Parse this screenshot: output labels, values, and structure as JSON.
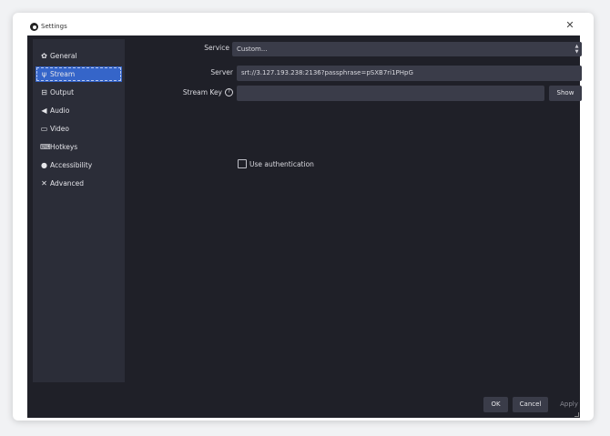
{
  "window": {
    "title": "Settings"
  },
  "sidebar": {
    "items": [
      {
        "label": "General",
        "icon": "gear-icon",
        "glyph": "✿"
      },
      {
        "label": "Stream",
        "icon": "antenna-icon",
        "glyph": "ψ"
      },
      {
        "label": "Output",
        "icon": "output-icon",
        "glyph": "⊟"
      },
      {
        "label": "Audio",
        "icon": "speaker-icon",
        "glyph": "◀"
      },
      {
        "label": "Video",
        "icon": "monitor-icon",
        "glyph": "▭"
      },
      {
        "label": "Hotkeys",
        "icon": "keyboard-icon",
        "glyph": "⌨"
      },
      {
        "label": "Accessibility",
        "icon": "accessibility-icon",
        "glyph": "●"
      },
      {
        "label": "Advanced",
        "icon": "tools-icon",
        "glyph": "✕"
      }
    ],
    "active": "Stream"
  },
  "stream": {
    "service_label": "Service",
    "service_value": "Custom...",
    "server_label": "Server",
    "server_value": "srt://3.127.193.238:2136?passphrase=pSXB7ri1PHpG",
    "stream_key_label": "Stream Key",
    "stream_key_value": "",
    "show_label": "Show",
    "use_auth_label": "Use authentication",
    "use_auth_checked": false
  },
  "footer": {
    "ok_label": "OK",
    "cancel_label": "Cancel",
    "apply_label": "Apply"
  },
  "colors": {
    "background": "#1f2028",
    "panel": "#2b2d38",
    "field": "#3a3c49",
    "accent": "#3565c9"
  }
}
